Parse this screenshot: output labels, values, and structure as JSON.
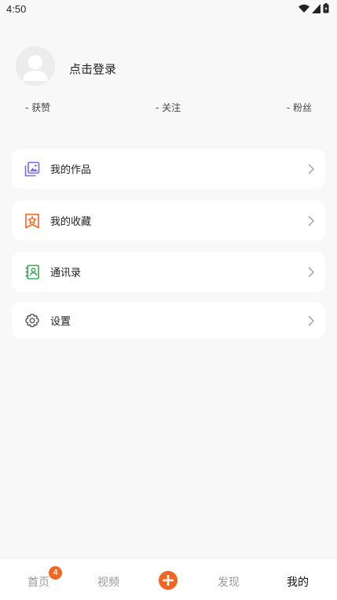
{
  "status_bar": {
    "time": "4:50",
    "icons": [
      "wifi-icon",
      "cell-signal-icon",
      "battery-icon"
    ]
  },
  "profile": {
    "login_text": "点击登录",
    "stats": {
      "likes": "- 获赞",
      "follow": "- 关注",
      "fans": "- 粉丝"
    }
  },
  "menu": {
    "items": [
      {
        "label": "我的作品",
        "icon": "gallery-icon",
        "color": "#7b68ee"
      },
      {
        "label": "我的收藏",
        "icon": "star-bookmark-icon",
        "color": "#f26522"
      },
      {
        "label": "通讯录",
        "icon": "contacts-book-icon",
        "color": "#3aa655"
      },
      {
        "label": "设置",
        "icon": "gear-icon",
        "color": "#555555"
      }
    ]
  },
  "bottom_nav": {
    "home": "首页",
    "home_badge": "4",
    "video": "视频",
    "discover": "发现",
    "mine": "我的",
    "accent": "#f26522"
  }
}
